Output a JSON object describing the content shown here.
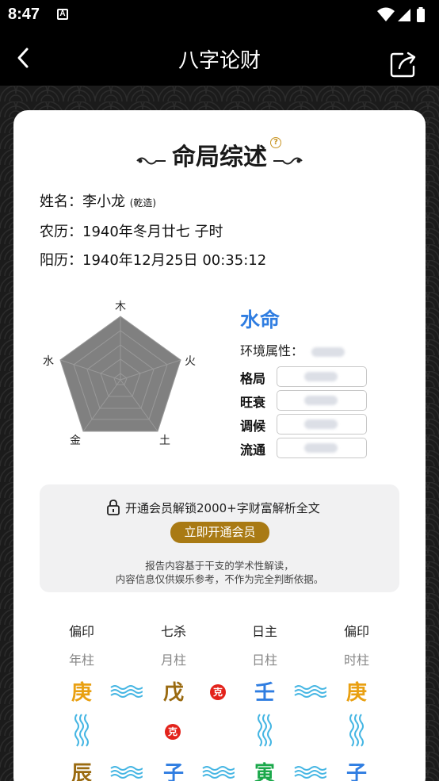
{
  "status_bar": {
    "time": "8:47",
    "notification_icon": "A"
  },
  "nav": {
    "title": "八字论财",
    "back_icon": "back-arrow-icon",
    "share_icon": "share-icon"
  },
  "summary": {
    "title": "命局综述",
    "help_icon": "?",
    "name_line": {
      "label": "姓名：",
      "value": "李小龙",
      "suffix": "(乾造)"
    },
    "lunar_line": {
      "label": "农历：",
      "value": "1940年冬月廿七 子时"
    },
    "solar_line": {
      "label": "阳历：",
      "value": "1940年12月25日 00:35:12"
    }
  },
  "radar": {
    "labels": {
      "top": "木",
      "right": "火",
      "bottom_right": "土",
      "bottom_left": "金",
      "left": "水"
    }
  },
  "fate": {
    "mingge": "水命",
    "env_label": "环境属性：",
    "attributes": [
      {
        "label": "格局"
      },
      {
        "label": "旺衰"
      },
      {
        "label": "调候"
      },
      {
        "label": "流通"
      }
    ]
  },
  "vip": {
    "text": "开通会员解锁2000+字财富解析全文",
    "button": "立即开通会员",
    "note_line1": "报告内容基于干支的学术性解读，",
    "note_line2": "内容信息仅供娱乐参考，不作为完全判断依据。"
  },
  "pillars": {
    "titles": [
      "偏印",
      "七杀",
      "日主",
      "偏印"
    ],
    "names": [
      "年柱",
      "月柱",
      "日柱",
      "时柱"
    ],
    "gan": [
      "庚",
      "戊",
      "壬",
      "庚"
    ],
    "zhi": [
      "辰",
      "子",
      "寅",
      "子"
    ],
    "ke_label": "克"
  },
  "colors": {
    "metal": "#e9a012",
    "earth": "#9a6a10",
    "water": "#2f7de1",
    "wood": "#1aa84a",
    "vip_button": "#a97a14",
    "ke_badge": "#e3231b"
  }
}
